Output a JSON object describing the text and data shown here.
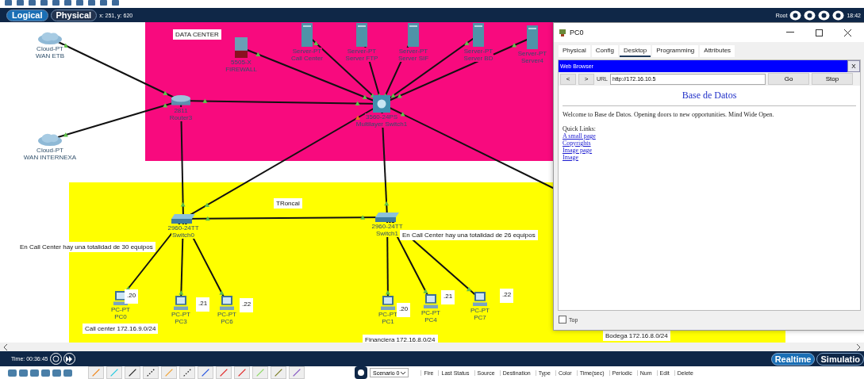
{
  "view_tabs": [
    {
      "label": "Logical",
      "selected": true
    },
    {
      "label": "Physical",
      "selected": false
    }
  ],
  "cursor_position": "x: 251, y: 620",
  "status_right": {
    "user": "Root",
    "clock": "18:42"
  },
  "zones": [
    {
      "color": "#f80a7e"
    },
    {
      "color": "#ffff00"
    }
  ],
  "devices": [
    {
      "kind": "cloud",
      "model": "Cloud-PT",
      "name": "WAN ETB"
    },
    {
      "kind": "cloud",
      "model": "Cloud-PT",
      "name": "WAN INTERNEXA"
    },
    {
      "kind": "router",
      "model": "2811",
      "name": "Router3"
    },
    {
      "kind": "firewall",
      "model": "5505-X",
      "name": "FIREWALL"
    },
    {
      "kind": "server",
      "model": "Server-PT",
      "name": "Call Center"
    },
    {
      "kind": "server",
      "model": "Server-PT",
      "name": "Server FTP"
    },
    {
      "kind": "server",
      "model": "Server-PT",
      "name": "Server SIF"
    },
    {
      "kind": "server",
      "model": "Server-PT",
      "name": "Server BD"
    },
    {
      "kind": "server",
      "model": "Server-PT",
      "name": "Server4"
    },
    {
      "kind": "multilayer",
      "model": "3560-24PS",
      "name": "Multilayer Switch1"
    },
    {
      "kind": "switch",
      "model": "2960-24TT",
      "name": "Switch0"
    },
    {
      "kind": "switch",
      "model": "2960-24TT",
      "name": "Switch1"
    },
    {
      "kind": "pc",
      "model": "PC-PT",
      "name": "PC0"
    },
    {
      "kind": "pc",
      "model": "PC-PT",
      "name": "PC3"
    },
    {
      "kind": "pc",
      "model": "PC-PT",
      "name": "PC6"
    },
    {
      "kind": "pc",
      "model": "PC-PT",
      "name": "PC1"
    },
    {
      "kind": "pc",
      "model": "PC-PT",
      "name": "PC4"
    },
    {
      "kind": "pc",
      "model": "PC-PT",
      "name": "PC7"
    }
  ],
  "notes": [
    "DATA CENTER",
    "TRoncal",
    "En Call Center hay una totalidad de 30 equipos",
    "En Call Center hay una totalidad de 26 equipos",
    "Call center 172.16.9.0/24",
    "Financiera 172.16.8.0/24",
    "Bodega 172.16.8.0/24"
  ],
  "address_labels": [
    ".20",
    ".21",
    ".22",
    ".20",
    ".21",
    ".22"
  ],
  "pc_window": {
    "title": "PC0",
    "tabs": [
      {
        "label": "Physical",
        "selected": false
      },
      {
        "label": "Config",
        "selected": false
      },
      {
        "label": "Desktop",
        "selected": true
      },
      {
        "label": "Programming",
        "selected": false
      },
      {
        "label": "Attributes",
        "selected": false
      }
    ],
    "browser": {
      "title": "Web Browser",
      "close": "X",
      "back": "<",
      "forward": ">",
      "url_label": "URL",
      "url": "http://172.16.10.5",
      "go": "Go",
      "stop": "Stop",
      "heading": "Base de Datos",
      "welcome": "Welcome to Base de Datos. Opening doors to new opportunities. Mind Wide Open.",
      "quick_links": "Quick Links:",
      "links": [
        "A small page",
        "Copyrights",
        "Image page",
        "Image"
      ]
    },
    "top_checkbox": {
      "label": "Top",
      "checked": false
    }
  },
  "time": "Time: 00:36:45",
  "modes": [
    {
      "label": "Realtime",
      "selected": true
    },
    {
      "label": "Simulatio",
      "selected": false
    }
  ],
  "scenario": "Scenario 0",
  "pdu_columns": [
    "Fire",
    "Last Status",
    "Source",
    "Destination",
    "Type",
    "Color",
    "Time(sec)",
    "Periodic",
    "Num",
    "Edit",
    "Delete"
  ]
}
